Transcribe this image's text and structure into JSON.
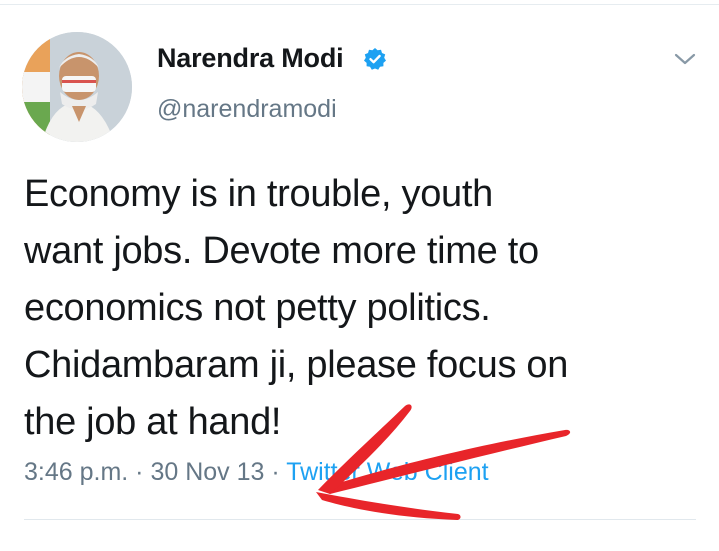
{
  "tweet": {
    "display_name": "Narendra Modi",
    "handle": "@narendramodi",
    "verified_icon": "verified-badge-icon",
    "caret_icon": "chevron-down-icon",
    "text": "Economy is in trouble, youth\nwant jobs. Devote more time to\neconomics not petty politics.\nChidambaram ji, please focus on\nthe job at hand!",
    "time": "3:46 p.m.",
    "separator": " · ",
    "date": "30 Nov 13",
    "client": "Twitter Web Client"
  },
  "colors": {
    "link": "#1da1f2",
    "meta": "#657786",
    "text": "#14171a",
    "annotation_arrow": "#e8252a"
  }
}
